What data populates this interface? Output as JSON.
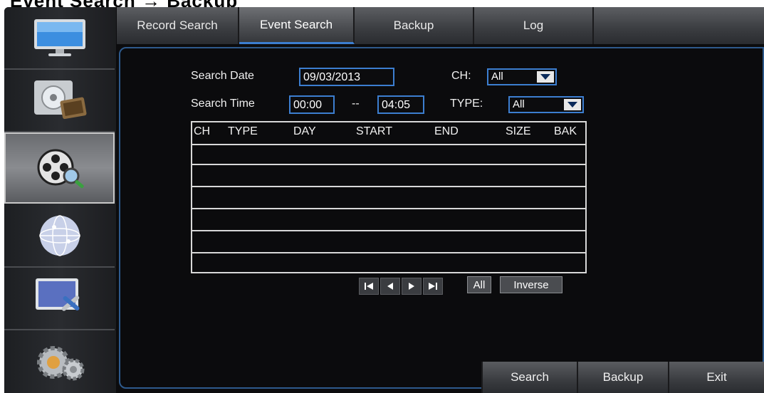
{
  "header_fragment": "Event Search → Backup",
  "tabs": [
    {
      "label": "Record Search",
      "active": false
    },
    {
      "label": "Event Search",
      "active": true
    },
    {
      "label": "Backup",
      "active": false
    },
    {
      "label": "Log",
      "active": false
    }
  ],
  "sidebar": {
    "items": [
      {
        "icon": "monitor-icon"
      },
      {
        "icon": "record-icon"
      },
      {
        "icon": "search-film-icon",
        "active": true
      },
      {
        "icon": "network-globe-icon"
      },
      {
        "icon": "system-tools-icon"
      },
      {
        "icon": "settings-gears-icon"
      }
    ]
  },
  "form": {
    "search_date_label": "Search Date",
    "search_date_value": "09/03/2013",
    "ch_label": "CH:",
    "ch_value": "All",
    "search_time_label": "Search Time",
    "time_start": "00:00",
    "time_sep": "--",
    "time_end": "04:05",
    "type_label": "TYPE:",
    "type_value": "All"
  },
  "table": {
    "headers": [
      "CH",
      "TYPE",
      "DAY",
      "START",
      "END",
      "SIZE",
      "BAK"
    ],
    "rows": 6
  },
  "pager": {
    "all_label": "All",
    "inverse_label": "Inverse"
  },
  "buttons": {
    "search": "Search",
    "backup": "Backup",
    "exit": "Exit"
  },
  "colors": {
    "accent": "#3c7ed0",
    "background": "#0c0c0e"
  }
}
